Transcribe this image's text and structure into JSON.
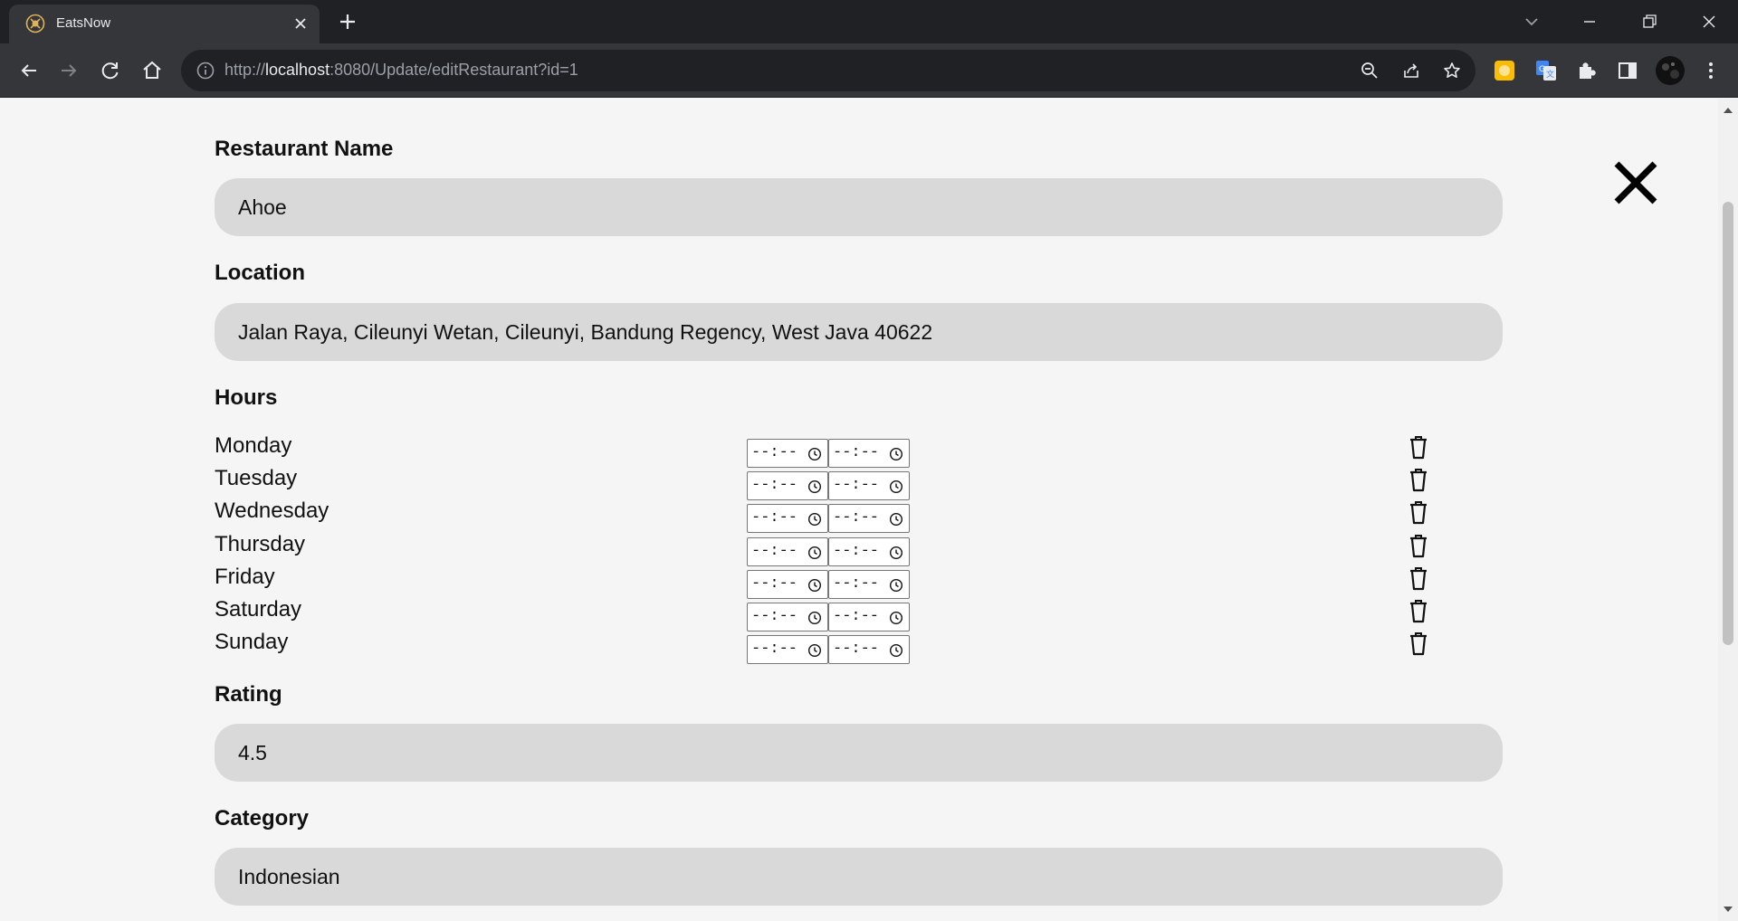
{
  "browser": {
    "tab_title": "EatsNow",
    "url_scheme": "http://",
    "url_host": "localhost",
    "url_path": ":8080/Update/editRestaurant?id=1"
  },
  "form": {
    "name_label": "Restaurant Name",
    "name_value": "Ahoe",
    "location_label": "Location",
    "location_value": "Jalan Raya, Cileunyi Wetan, Cileunyi, Bandung Regency, West Java 40622",
    "hours_label": "Hours",
    "hours": [
      {
        "day": "Monday",
        "open": "--:--",
        "close": "--:--"
      },
      {
        "day": "Tuesday",
        "open": "--:--",
        "close": "--:--"
      },
      {
        "day": "Wednesday",
        "open": "--:--",
        "close": "--:--"
      },
      {
        "day": "Thursday",
        "open": "--:--",
        "close": "--:--"
      },
      {
        "day": "Friday",
        "open": "--:--",
        "close": "--:--"
      },
      {
        "day": "Saturday",
        "open": "--:--",
        "close": "--:--"
      },
      {
        "day": "Sunday",
        "open": "--:--",
        "close": "--:--"
      }
    ],
    "rating_label": "Rating",
    "rating_value": "4.5",
    "category_label": "Category",
    "category_value": "Indonesian"
  },
  "colors": {
    "page_bg": "#f5f5f5",
    "input_bg": "#d9d9d9",
    "chrome_dark": "#202124",
    "chrome_toolbar": "#35363a"
  }
}
